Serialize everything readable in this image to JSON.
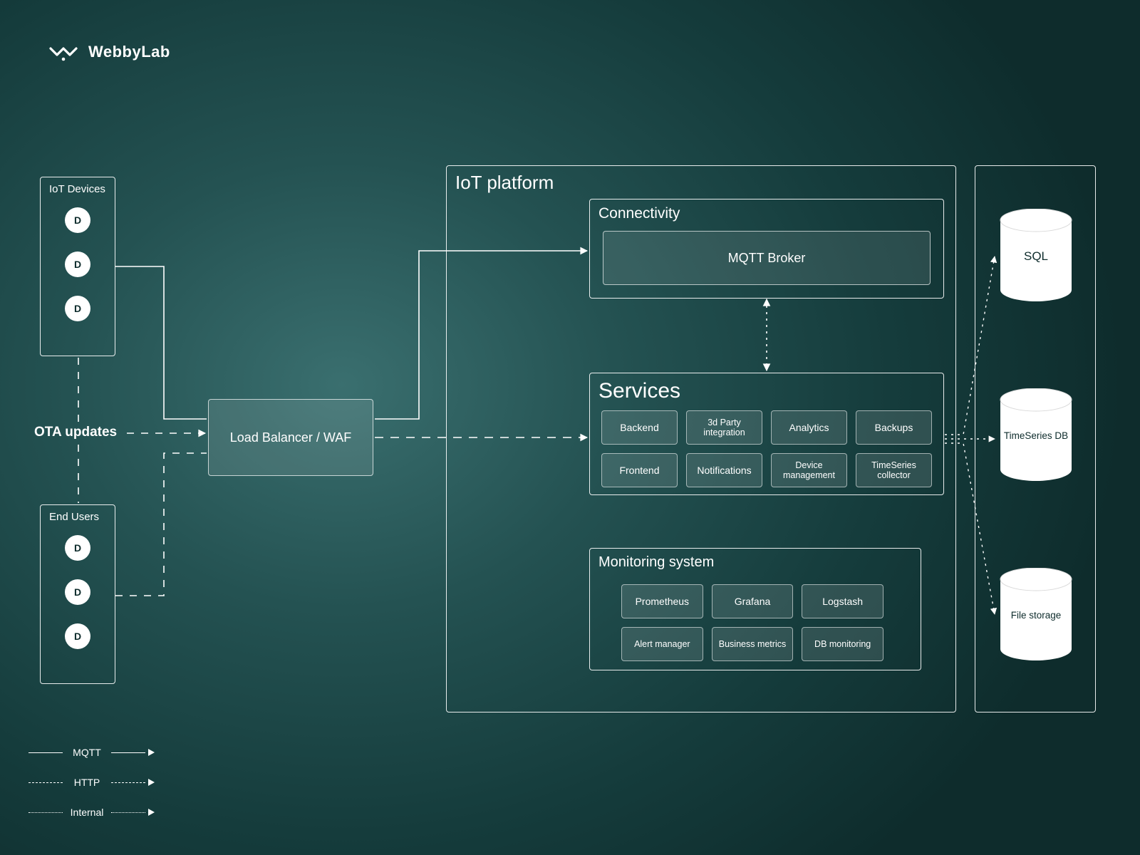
{
  "brand": {
    "name": "WebbyLab"
  },
  "left": {
    "iot_devices": {
      "title": "IoT Devices",
      "d_label": "D"
    },
    "end_users": {
      "title": "End Users",
      "d_label": "D"
    },
    "ota": "OTA updates"
  },
  "load_balancer": {
    "label": "Load Balancer / WAF"
  },
  "platform": {
    "title": "IoT platform",
    "connectivity": {
      "title": "Connectivity",
      "broker": "MQTT Broker"
    },
    "services": {
      "title": "Services",
      "tiles": [
        "Backend",
        "3d Party integration",
        "Analytics",
        "Backups",
        "Frontend",
        "Notifications",
        "Device management",
        "TimeSeries collector"
      ]
    },
    "monitoring": {
      "title": "Monitoring system",
      "tiles": [
        "Prometheus",
        "Grafana",
        "Logstash",
        "Alert manager",
        "Business metrics",
        "DB monitoring"
      ]
    }
  },
  "databases": {
    "sql": "SQL",
    "ts": "TimeSeries DB",
    "file": "File storage"
  },
  "legend": {
    "mqtt": "MQTT",
    "http": "HTTP",
    "internal": "Internal"
  }
}
